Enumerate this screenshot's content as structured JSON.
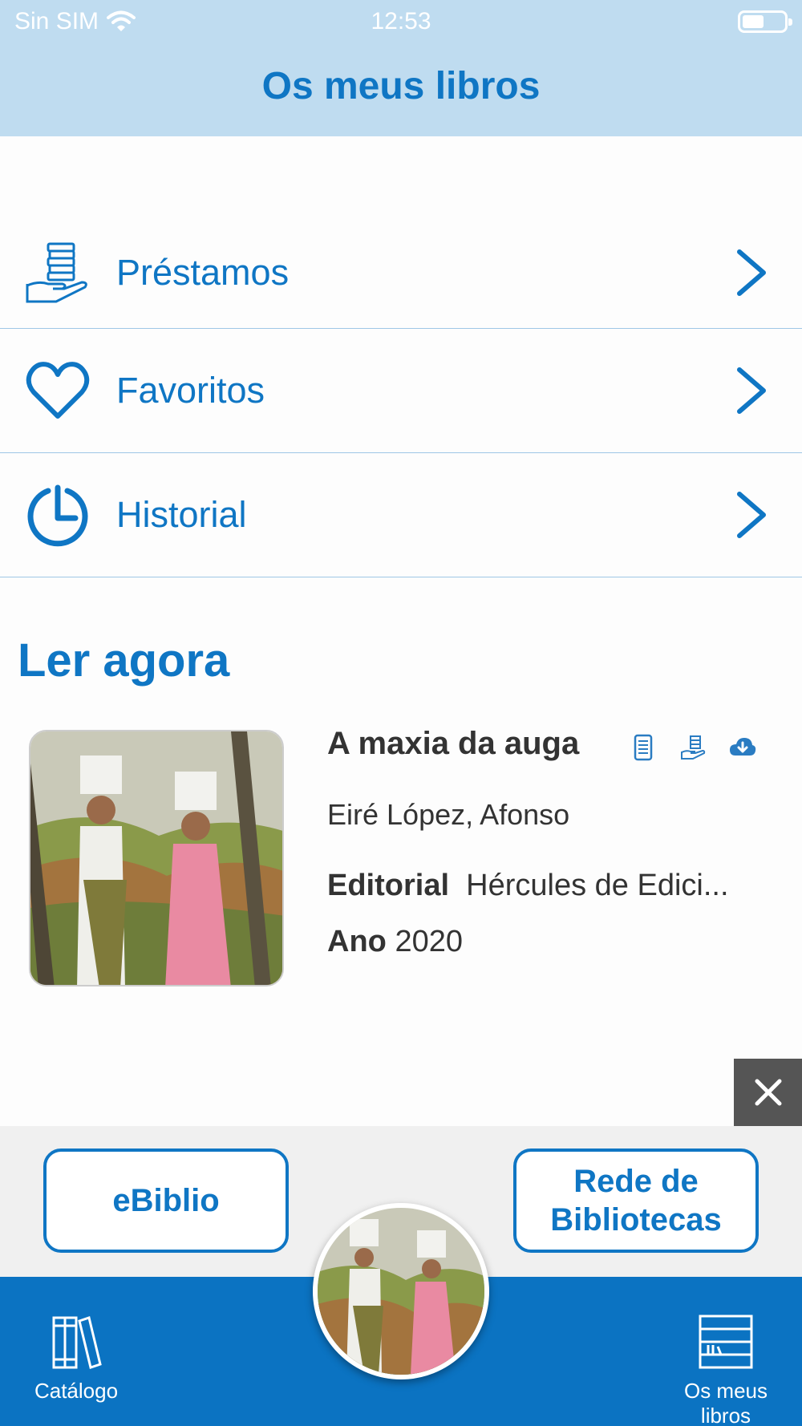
{
  "status_bar": {
    "carrier": "Sin SIM",
    "time": "12:53"
  },
  "header": {
    "title": "Os meus libros"
  },
  "menu": [
    {
      "label": "Préstamos",
      "icon": "hand-with-books-icon"
    },
    {
      "label": "Favoritos",
      "icon": "heart-icon"
    },
    {
      "label": "Historial",
      "icon": "history-clock-icon"
    }
  ],
  "read_now": {
    "title": "Ler agora",
    "book": {
      "title": "A maxia da auga",
      "author": "Eiré López, Afonso",
      "publisher_label": "Editorial",
      "publisher": "Hércules de Edici...",
      "year_label": "Ano",
      "year": "2020",
      "icons": [
        "ebook-reader-icon",
        "loan-hand-icon",
        "cloud-download-icon"
      ]
    }
  },
  "banner": {
    "left_button": "eBiblio",
    "right_button": "Rede de Bibliotecas"
  },
  "tabbar": {
    "left": {
      "label": "Catálogo",
      "icon": "books-icon"
    },
    "right": {
      "label": "Os meus libros",
      "icon": "bookshelf-icon"
    }
  },
  "colors": {
    "accent": "#0f76c4",
    "header_bg": "#bfdcf0",
    "tabbar_bg": "#0b73c2",
    "divider": "#9fc7e6"
  }
}
